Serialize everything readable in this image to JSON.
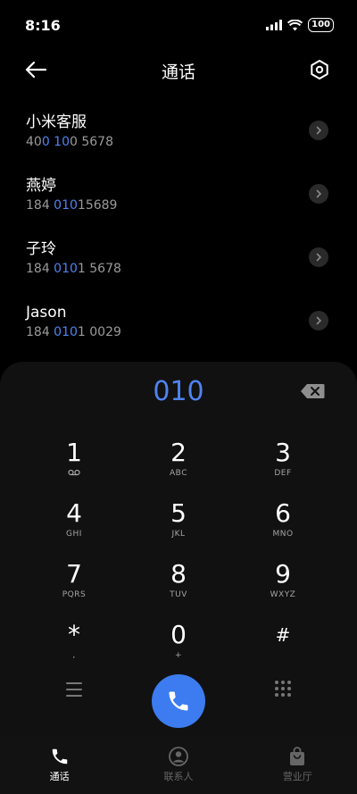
{
  "status_bar": {
    "time": "8:16",
    "battery": "100"
  },
  "header": {
    "title": "通话"
  },
  "contacts": [
    {
      "name": "小米客服",
      "number_parts": [
        "40",
        "0 10",
        "0 5678"
      ]
    },
    {
      "name": "燕婷",
      "number_parts": [
        "184 ",
        "010",
        "15689"
      ]
    },
    {
      "name": "子玲",
      "number_parts": [
        "184 ",
        "010",
        "1 5678"
      ]
    },
    {
      "name": "Jason",
      "number_parts": [
        "184 ",
        "010",
        "1 0029"
      ]
    }
  ],
  "dialpad": {
    "display": "010",
    "keys": [
      {
        "digit": "1",
        "letters": "ꝏ"
      },
      {
        "digit": "2",
        "letters": "ABC"
      },
      {
        "digit": "3",
        "letters": "DEF"
      },
      {
        "digit": "4",
        "letters": "GHI"
      },
      {
        "digit": "5",
        "letters": "JKL"
      },
      {
        "digit": "6",
        "letters": "MNO"
      },
      {
        "digit": "7",
        "letters": "PQRS"
      },
      {
        "digit": "8",
        "letters": "TUV"
      },
      {
        "digit": "9",
        "letters": "WXYZ"
      },
      {
        "digit": "*",
        "letters": ","
      },
      {
        "digit": "0",
        "letters": "+"
      },
      {
        "digit": "#",
        "letters": ""
      }
    ]
  },
  "bottom_nav": {
    "items": [
      {
        "label": "通话",
        "icon": "phone-icon",
        "active": true
      },
      {
        "label": "联系人",
        "icon": "person-icon",
        "active": false
      },
      {
        "label": "营业厅",
        "icon": "bag-icon",
        "active": false
      }
    ]
  },
  "colors": {
    "accent": "#3c7cf0",
    "highlight": "#4f83f1"
  }
}
